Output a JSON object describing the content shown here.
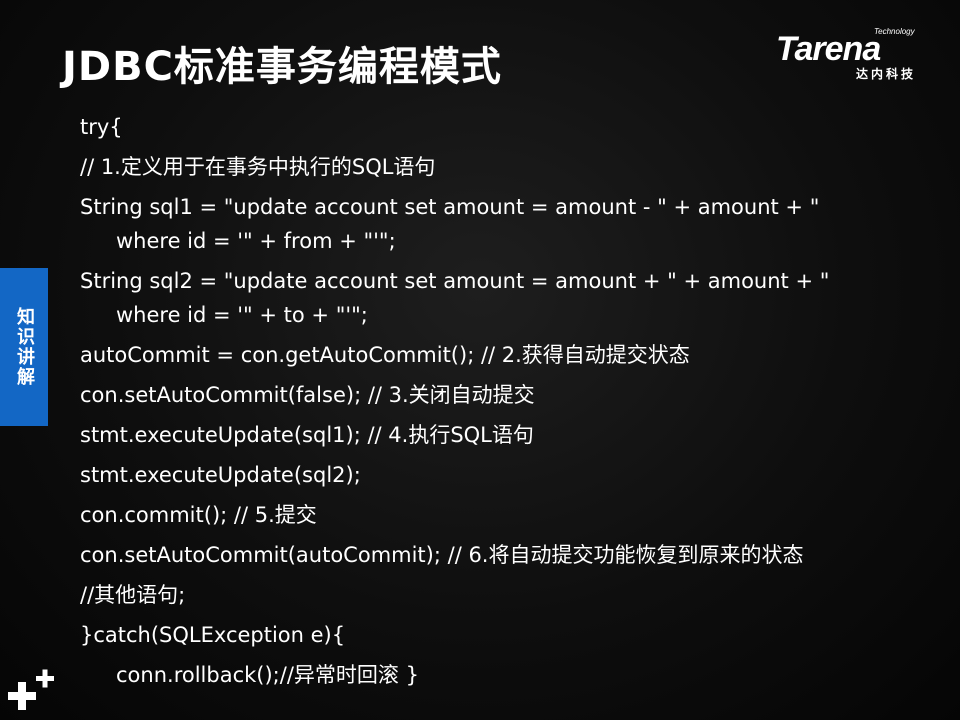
{
  "slide": {
    "title": "JDBC标准事务编程模式",
    "side_tab": "知识讲解",
    "logo": {
      "small_text": "Technology",
      "brand": "Tarena",
      "subtitle": "达内科技"
    },
    "code_lines": [
      {
        "text": "try{"
      },
      {
        "text": "// 1.定义用于在事务中执行的SQL语句"
      },
      {
        "text": "String sql1 = \"update account set amount = amount - \" + amount + \"",
        "cont": "where id = '\" + from + \"'\";"
      },
      {
        "text": "String sql2 = \"update account set amount = amount + \" + amount + \"",
        "cont": "where id = '\" + to + \"'\";"
      },
      {
        "text": "autoCommit = con.getAutoCommit(); // 2.获得自动提交状态"
      },
      {
        "text": "con.setAutoCommit(false); // 3.关闭自动提交"
      },
      {
        "text": "stmt.executeUpdate(sql1); // 4.执行SQL语句"
      },
      {
        "text": "stmt.executeUpdate(sql2);"
      },
      {
        "text": "con.commit(); // 5.提交"
      },
      {
        "text": "con.setAutoCommit(autoCommit); // 6.将自动提交功能恢复到原来的状态"
      },
      {
        "text": "//其他语句;"
      },
      {
        "text": "}catch(SQLException e){"
      },
      {
        "text": "conn.rollback();//异常时回滚 }"
      }
    ]
  },
  "colors": {
    "background": "#0e0e0e",
    "text": "#ffffff",
    "side_tab": "#1367c5"
  }
}
